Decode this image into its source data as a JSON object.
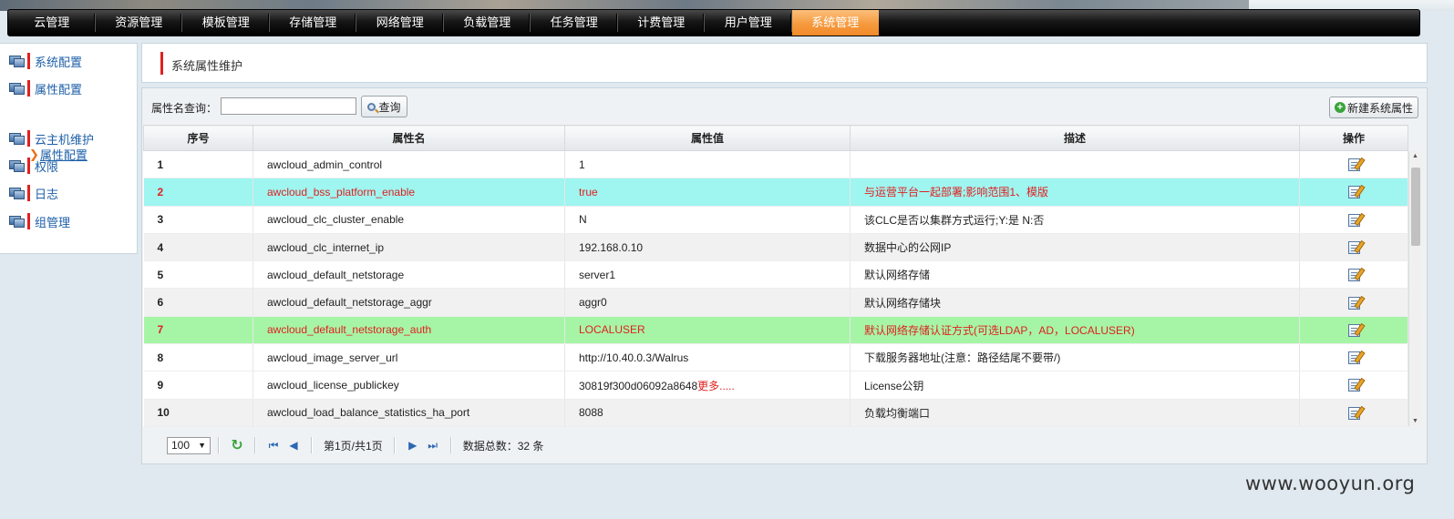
{
  "nav": {
    "tabs": [
      {
        "label": "云管理"
      },
      {
        "label": "资源管理"
      },
      {
        "label": "模板管理"
      },
      {
        "label": "存储管理"
      },
      {
        "label": "网络管理"
      },
      {
        "label": "负载管理"
      },
      {
        "label": "任务管理"
      },
      {
        "label": "计费管理"
      },
      {
        "label": "用户管理"
      },
      {
        "label": "系统管理",
        "active": true
      }
    ]
  },
  "sidebar": {
    "items": [
      {
        "label": "系统配置",
        "icon": "computer-icon"
      },
      {
        "label": "属性配置",
        "icon": "computer-icon"
      },
      {
        "label": "云主机维护",
        "icon": "computer-icon"
      },
      {
        "label": "权限",
        "icon": "computer-icon"
      },
      {
        "label": "日志",
        "icon": "computer-icon"
      },
      {
        "label": "组管理",
        "icon": "computer-icon"
      }
    ],
    "subitem": {
      "label": "属性配置",
      "icon": "chevron-right-icon"
    }
  },
  "breadcrumb": {
    "title": "系统属性维护"
  },
  "search": {
    "label": "属性名查询：",
    "value": "",
    "placeholder": "",
    "button_label": "查询",
    "new_button_label": "新建系统属性"
  },
  "table": {
    "columns": [
      "序号",
      "属性名",
      "属性值",
      "描述",
      "操作"
    ],
    "rows": [
      {
        "no": "1",
        "name": "awcloud_admin_control",
        "value": "1",
        "more": "",
        "desc": "",
        "style": ""
      },
      {
        "no": "2",
        "name": "awcloud_bss_platform_enable",
        "value": "true",
        "more": "",
        "desc": "与运营平台一起部署;影响范围1、模版",
        "style": "cyan"
      },
      {
        "no": "3",
        "name": "awcloud_clc_cluster_enable",
        "value": "N",
        "more": "",
        "desc": "该CLC是否以集群方式运行;Y:是 N:否",
        "style": ""
      },
      {
        "no": "4",
        "name": "awcloud_clc_internet_ip",
        "value": "192.168.0.10",
        "more": "",
        "desc": "数据中心的公网IP",
        "style": "alt"
      },
      {
        "no": "5",
        "name": "awcloud_default_netstorage",
        "value": "server1",
        "more": "",
        "desc": "默认网络存储",
        "style": ""
      },
      {
        "no": "6",
        "name": "awcloud_default_netstorage_aggr",
        "value": "aggr0",
        "more": "",
        "desc": "默认网络存储块",
        "style": "alt"
      },
      {
        "no": "7",
        "name": "awcloud_default_netstorage_auth",
        "value": "LOCALUSER",
        "more": "",
        "desc": "默认网络存储认证方式(可选LDAP，AD，LOCALUSER)",
        "style": "green"
      },
      {
        "no": "8",
        "name": "awcloud_image_server_url",
        "value": "http://10.40.0.3/Walrus",
        "more": "",
        "desc": "下载服务器地址(注意：路径结尾不要带/)",
        "style": ""
      },
      {
        "no": "9",
        "name": "awcloud_license_publickey",
        "value": "30819f300d06092a8648",
        "more": "更多.....",
        "desc": "License公钥",
        "style": ""
      },
      {
        "no": "10",
        "name": "awcloud_load_balance_statistics_ha_port",
        "value": "8088",
        "more": "",
        "desc": "负载均衡端口",
        "style": "alt"
      }
    ]
  },
  "pager": {
    "page_size": "100",
    "page_info": "第1页/共1页",
    "total": "数据总数：32 条"
  },
  "watermark": "www.wooyun.org",
  "colors": {
    "accent_red": "#e02020",
    "active_tab": "#f59a3e",
    "link_blue": "#1d5fa8",
    "row_cyan": "#9ff5f0",
    "row_green": "#a6f5a6"
  }
}
